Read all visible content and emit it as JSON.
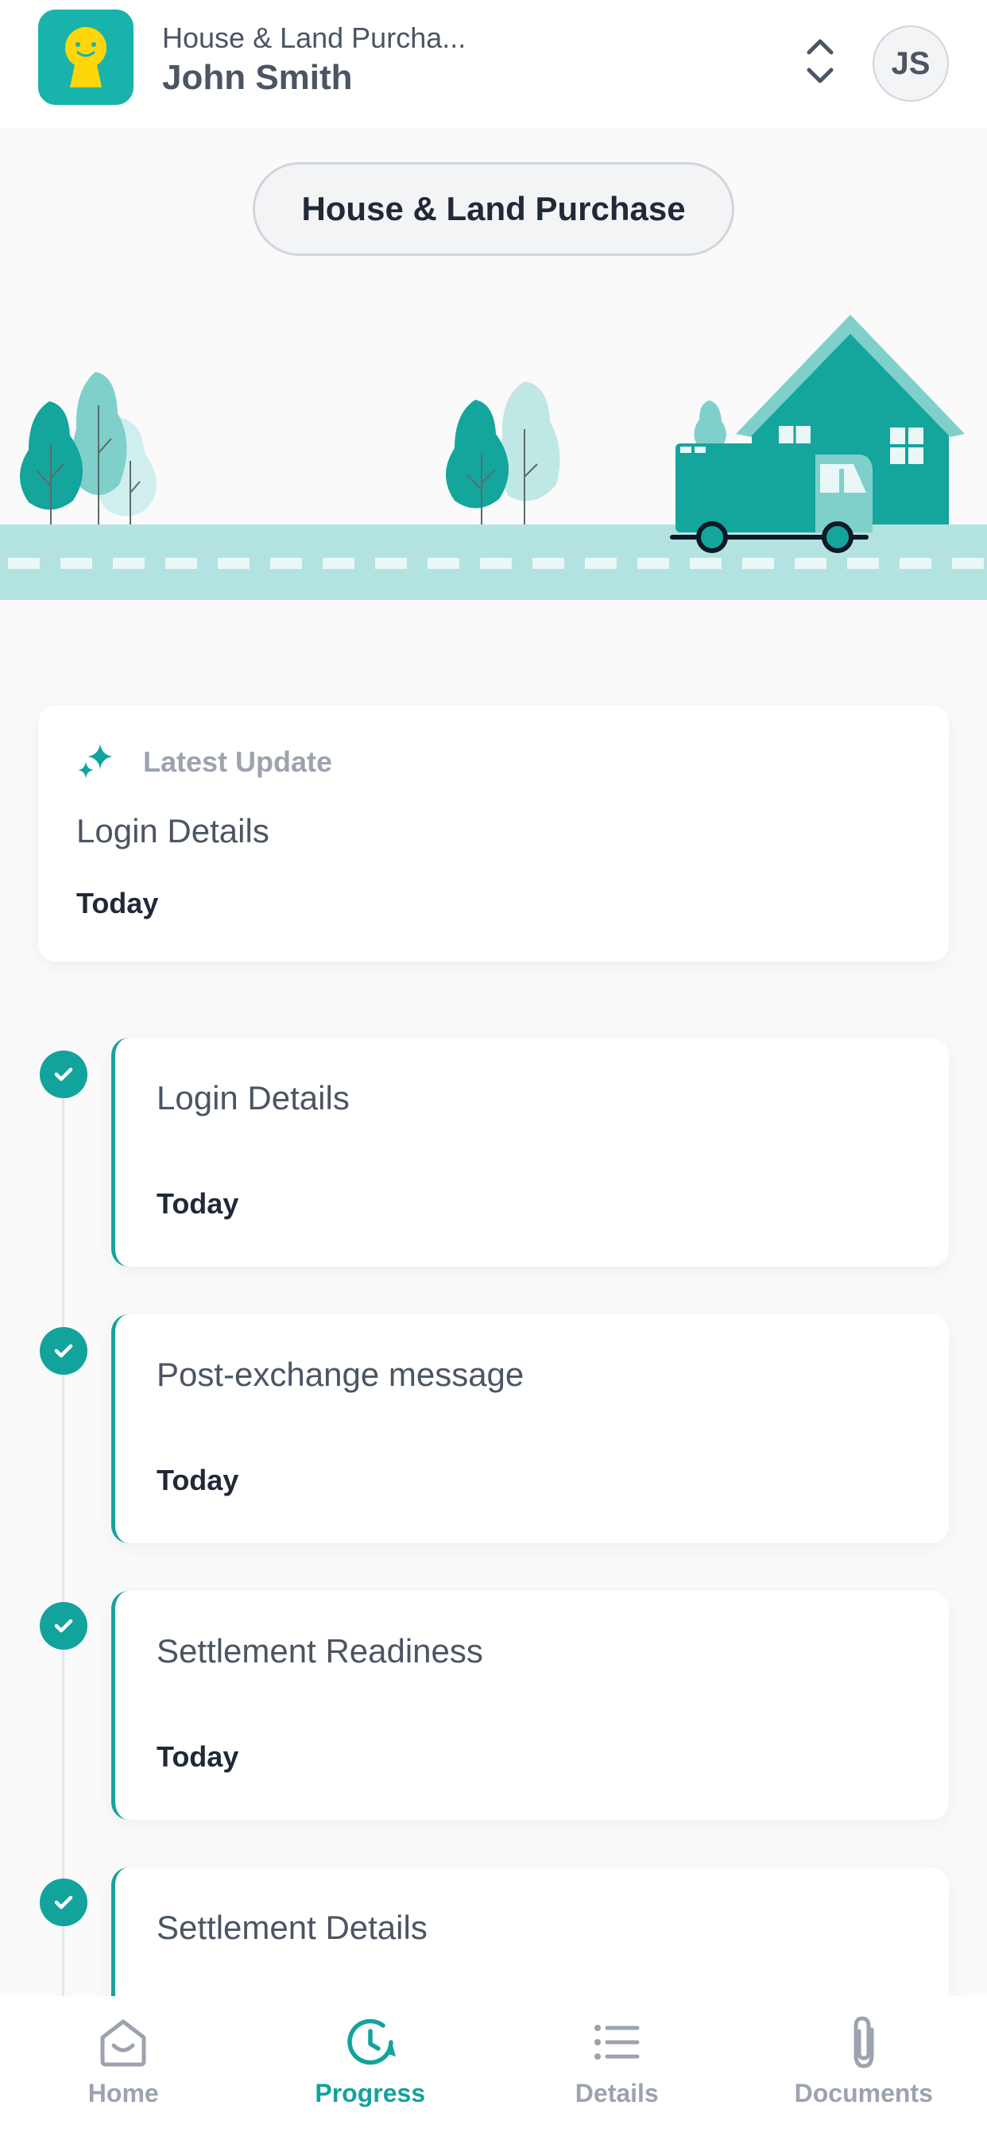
{
  "header": {
    "matter_subtitle": "House & Land Purcha...",
    "client_name": "John Smith",
    "avatar_initials": "JS",
    "matter_type": "House & Land Purchase"
  },
  "latest_update": {
    "label": "Latest Update",
    "title": "Login Details",
    "date": "Today"
  },
  "timeline": [
    {
      "title": "Login Details",
      "date": "Today",
      "completed": true
    },
    {
      "title": "Post-exchange message",
      "date": "Today",
      "completed": true
    },
    {
      "title": "Settlement Readiness",
      "date": "Today",
      "completed": true
    },
    {
      "title": "Settlement Details",
      "date": "",
      "completed": true
    }
  ],
  "nav": {
    "home": "Home",
    "progress": "Progress",
    "details": "Details",
    "documents": "Documents",
    "active": "progress"
  },
  "colors": {
    "brand_teal": "#17b3ac",
    "accent_teal": "#11a39c",
    "logo_yellow": "#ffd60a",
    "road_light": "#b3e3e0"
  },
  "icons": {
    "logo": "keyhole-face-logo",
    "switcher": "chevron-up-down-icon",
    "latest": "sparkle-icon",
    "check": "check-circle-icon",
    "nav_home": "home-icon",
    "nav_progress": "clock-refresh-icon",
    "nav_details": "list-icon",
    "nav_documents": "paperclip-icon"
  }
}
